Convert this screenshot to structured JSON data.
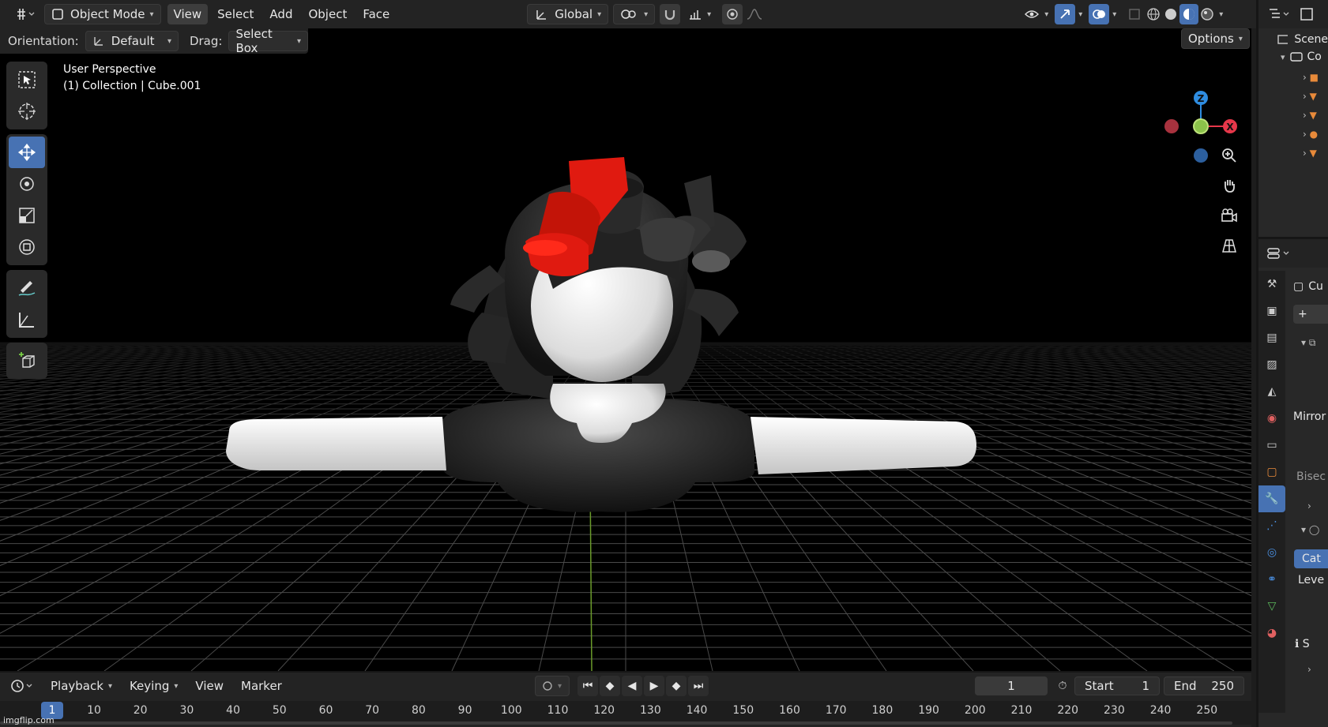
{
  "header": {
    "mode": "Object Mode",
    "menus": [
      "View",
      "Select",
      "Add",
      "Object",
      "Face"
    ],
    "transform_orientation": "Global"
  },
  "tool_header": {
    "orientation_label": "Orientation:",
    "orientation_value": "Default",
    "drag_label": "Drag:",
    "drag_value": "Select Box",
    "options": "Options"
  },
  "viewport": {
    "perspective": "User Perspective",
    "collection": "(1) Collection | Cube.001",
    "gizmo": {
      "z": "Z",
      "x": "X"
    }
  },
  "outliner": {
    "scene": "Scene",
    "collection_abbrev": "Co"
  },
  "properties": {
    "object_abbrev": "Cu",
    "mirror": "Mirror",
    "bisect": "Bisec",
    "cat": "Cat",
    "level": "Leve",
    "s": "S"
  },
  "timeline": {
    "menus": [
      "Playback",
      "Keying",
      "View",
      "Marker"
    ],
    "current_frame": "1",
    "start_label": "Start",
    "start_value": "1",
    "end_label": "End",
    "end_value": "250",
    "ticks": [
      "1",
      "10",
      "20",
      "30",
      "40",
      "50",
      "60",
      "70",
      "80",
      "90",
      "100",
      "110",
      "120",
      "130",
      "140",
      "150",
      "160",
      "170",
      "180",
      "190",
      "200",
      "210",
      "220",
      "230",
      "240",
      "250"
    ]
  },
  "watermark": "imgflip.com",
  "colors": {
    "accent": "#4772b3",
    "red_hat": "#e01a10",
    "gizmo_x": "#e6374a",
    "gizmo_y": "#8bc34a",
    "gizmo_z": "#2e8ce0"
  }
}
